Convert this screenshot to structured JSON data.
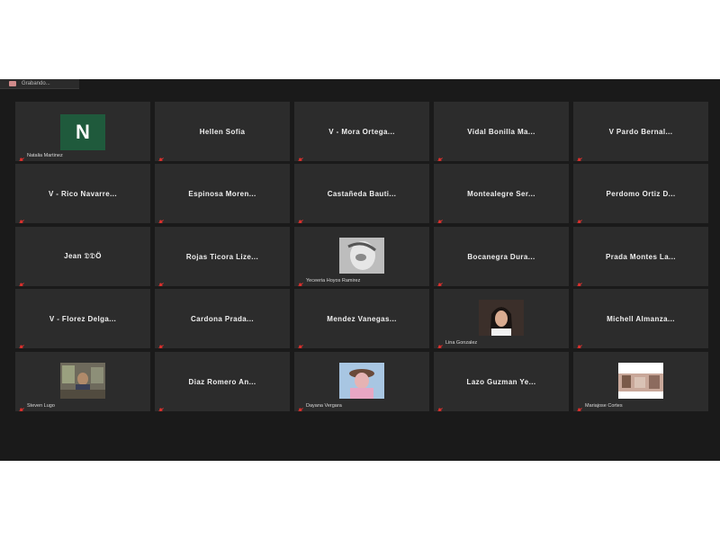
{
  "window": {
    "tab_title": "Grabando..."
  },
  "participants": [
    {
      "name": "Natalia Martinez",
      "display": "small",
      "avatar": "letter",
      "initial": "N",
      "muted": true
    },
    {
      "name": "Hellen Sofia",
      "display": "center",
      "muted": true
    },
    {
      "name": "V - Mora Ortega...",
      "display": "center",
      "muted": true
    },
    {
      "name": "Vidal Bonilla Ma...",
      "display": "center",
      "muted": true
    },
    {
      "name": "V Pardo Bernal...",
      "display": "center",
      "muted": true
    },
    {
      "name": "V - Rico Navarre...",
      "display": "center",
      "muted": true
    },
    {
      "name": "Espinosa Moren...",
      "display": "center",
      "muted": true
    },
    {
      "name": "Castañeda Bauti...",
      "display": "center",
      "muted": true
    },
    {
      "name": "Montealegre Ser...",
      "display": "center",
      "muted": true
    },
    {
      "name": "Perdomo Ortiz D...",
      "display": "center",
      "muted": true
    },
    {
      "name": "Jean 𝔇𝔇Ö",
      "display": "center",
      "muted": true
    },
    {
      "name": "Rojas Ticora Lize...",
      "display": "center",
      "muted": true
    },
    {
      "name": "Yeceeria Hoyos Ramirez",
      "display": "small",
      "avatar": "photo",
      "photo_style": "gray",
      "muted": true
    },
    {
      "name": "Bocanegra Dura...",
      "display": "center",
      "muted": true
    },
    {
      "name": "Prada Montes La...",
      "display": "center",
      "muted": true
    },
    {
      "name": "V - Florez Delga...",
      "display": "center",
      "muted": true
    },
    {
      "name": "Cardona Prada...",
      "display": "center",
      "muted": true
    },
    {
      "name": "Mendez Vanegas...",
      "display": "center",
      "muted": true
    },
    {
      "name": "Lina Gonzalez",
      "display": "small",
      "avatar": "photo",
      "photo_style": "portrait",
      "muted": true
    },
    {
      "name": "Michell Almanza...",
      "display": "center",
      "muted": true
    },
    {
      "name": "Steven Lugo",
      "display": "small",
      "avatar": "photo",
      "photo_style": "room",
      "muted": true
    },
    {
      "name": "Diaz Romero An...",
      "display": "center",
      "muted": true
    },
    {
      "name": "Dayana Vergara",
      "display": "small",
      "avatar": "photo",
      "photo_style": "pink",
      "muted": true
    },
    {
      "name": "Lazo Guzman Ye...",
      "display": "center",
      "muted": true
    },
    {
      "name": "Mariajose Cortes",
      "display": "small",
      "avatar": "photo",
      "photo_style": "collage",
      "muted": true
    }
  ],
  "taskbar": {
    "items": [
      {
        "name": "start-button",
        "icon": "windows-logo-icon"
      },
      {
        "name": "search-button",
        "icon": "search-icon"
      },
      {
        "name": "task-view-button",
        "icon": "task-view-icon"
      },
      {
        "name": "edge-button",
        "icon": "edge-icon"
      },
      {
        "name": "file-explorer-button",
        "icon": "folder-icon"
      },
      {
        "name": "store-button",
        "icon": "store-icon"
      },
      {
        "name": "mail-button",
        "icon": "mail-icon"
      },
      {
        "name": "work-app-button",
        "icon": "briefcase-icon"
      },
      {
        "name": "chrome-button",
        "icon": "chrome-icon"
      },
      {
        "name": "skype-button",
        "icon": "skype-icon"
      },
      {
        "name": "zoom-button",
        "icon": "zoom-icon",
        "active": true
      },
      {
        "name": "word-button",
        "icon": "word-icon"
      }
    ]
  },
  "colors": {
    "tile_background": "#2c2c2c",
    "screen_background": "#1a1a1a",
    "mute_red": "#e0302d",
    "avatar_green": "#1f5a3c"
  }
}
